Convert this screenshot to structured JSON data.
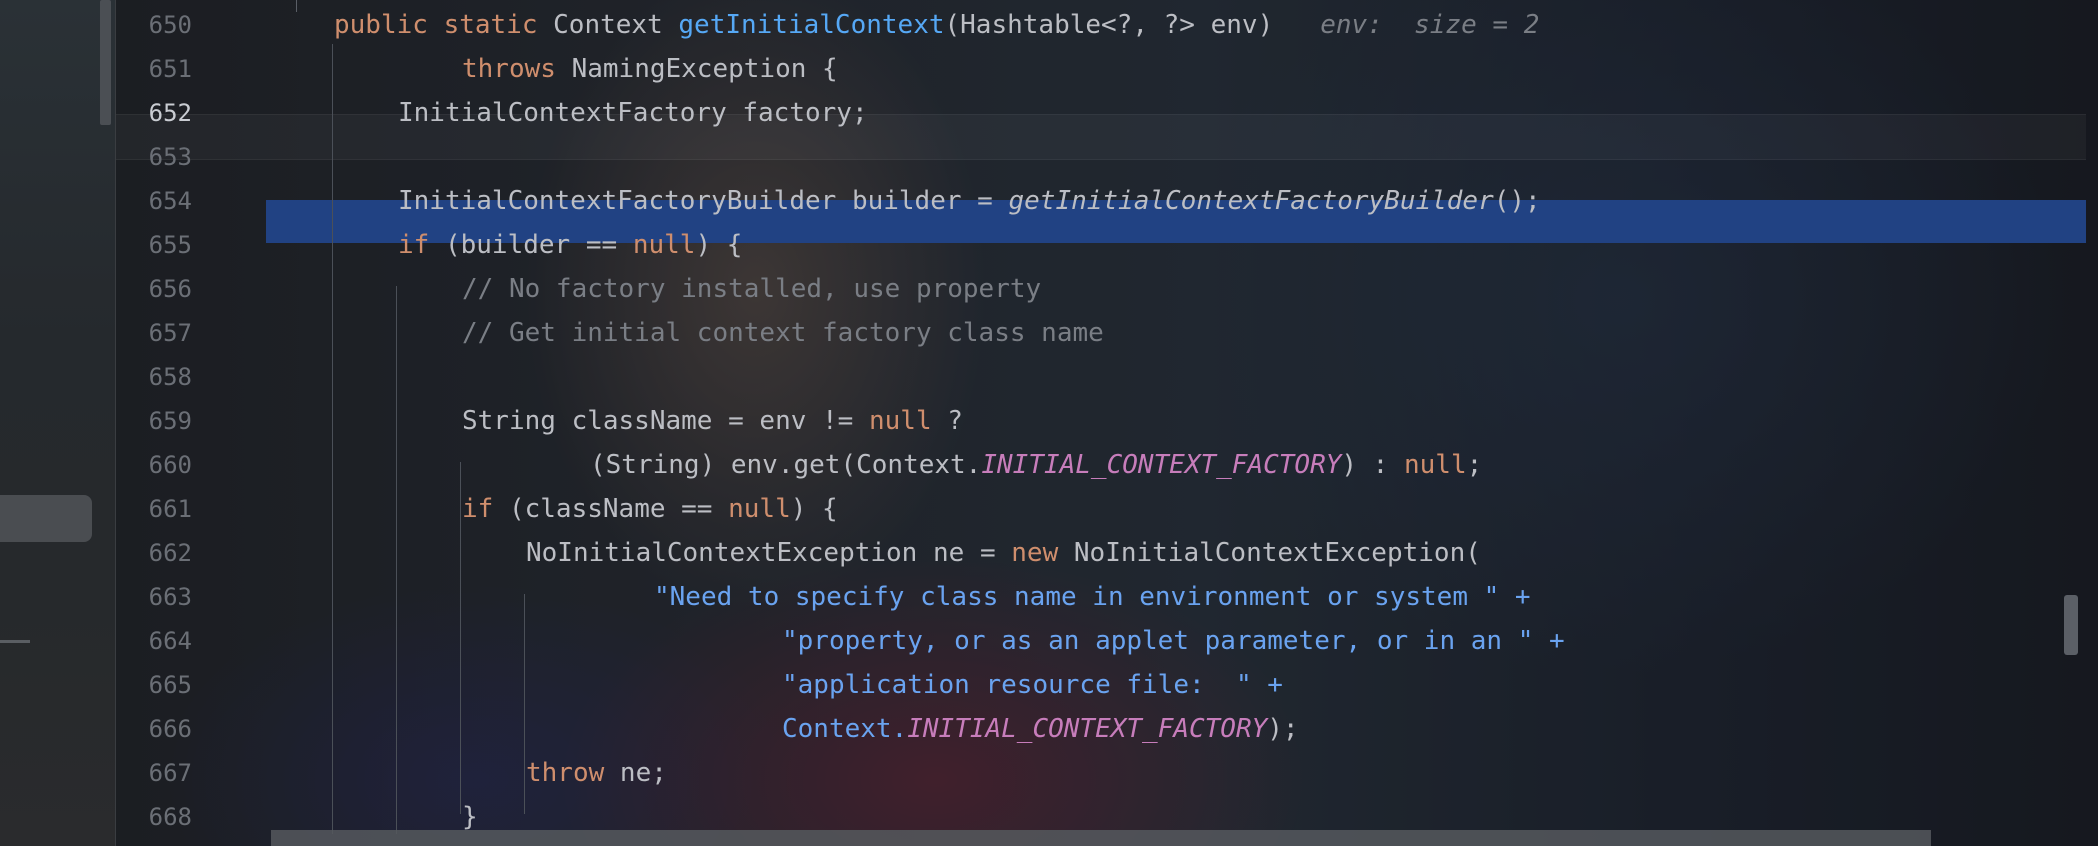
{
  "editor": {
    "lines": [
      {
        "num": "650",
        "indent": 0,
        "tokens": [
          {
            "t": "public static ",
            "c": "kw"
          },
          {
            "t": "Context "
          },
          {
            "t": "getInitialContext",
            "c": "fn"
          },
          {
            "t": "(Hashtable<?, ?> env)"
          },
          {
            "t": "   env:  size = 2",
            "c": "hint"
          }
        ]
      },
      {
        "num": "651",
        "indent": 2,
        "tokens": [
          {
            "t": "throws ",
            "c": "kw"
          },
          {
            "t": "NamingException {"
          }
        ]
      },
      {
        "num": "652",
        "indent": 1,
        "active": true,
        "tokens": [
          {
            "t": "InitialContextFactory factory;"
          }
        ]
      },
      {
        "num": "653",
        "indent": 0,
        "tokens": []
      },
      {
        "num": "654",
        "indent": 1,
        "tokens": [
          {
            "t": "InitialContextFactoryBuilder builder = "
          },
          {
            "t": "getInitialContextFactoryBuilder",
            "c": "it"
          },
          {
            "t": "();"
          }
        ]
      },
      {
        "num": "655",
        "indent": 1,
        "tokens": [
          {
            "t": "if ",
            "c": "kw"
          },
          {
            "t": "(builder == "
          },
          {
            "t": "null",
            "c": "kw"
          },
          {
            "t": ") {"
          }
        ]
      },
      {
        "num": "656",
        "indent": 2,
        "tokens": [
          {
            "t": "// No factory installed, use property",
            "c": "cm"
          }
        ]
      },
      {
        "num": "657",
        "indent": 2,
        "tokens": [
          {
            "t": "// Get initial context factory class name",
            "c": "cm"
          }
        ]
      },
      {
        "num": "658",
        "indent": 0,
        "tokens": []
      },
      {
        "num": "659",
        "indent": 2,
        "tokens": [
          {
            "t": "String className = env != "
          },
          {
            "t": "null",
            "c": "kw"
          },
          {
            "t": " ?"
          }
        ]
      },
      {
        "num": "660",
        "indent": 4,
        "tokens": [
          {
            "t": "(String) env.get(Context."
          },
          {
            "t": "INITIAL_CONTEXT_FACTORY",
            "c": "cn"
          },
          {
            "t": ") : "
          },
          {
            "t": "null",
            "c": "kw"
          },
          {
            "t": ";"
          }
        ]
      },
      {
        "num": "661",
        "indent": 2,
        "tokens": [
          {
            "t": "if ",
            "c": "kw"
          },
          {
            "t": "(className == "
          },
          {
            "t": "null",
            "c": "kw"
          },
          {
            "t": ") {"
          }
        ]
      },
      {
        "num": "662",
        "indent": 3,
        "tokens": [
          {
            "t": "NoInitialContextException ne = "
          },
          {
            "t": "new ",
            "c": "kw"
          },
          {
            "t": "NoInitialContextException("
          }
        ]
      },
      {
        "num": "663",
        "indent": 5,
        "tokens": [
          {
            "t": "\"Need to specify class name in environment or system \" +",
            "c": "st"
          }
        ]
      },
      {
        "num": "664",
        "indent": 7,
        "tokens": [
          {
            "t": "\"property, or as an applet parameter, or in an \" +",
            "c": "st"
          }
        ]
      },
      {
        "num": "665",
        "indent": 7,
        "tokens": [
          {
            "t": "\"application resource file:  \" +",
            "c": "st"
          }
        ]
      },
      {
        "num": "666",
        "indent": 7,
        "tokens": [
          {
            "t": "Context.",
            "c": "st"
          },
          {
            "t": "INITIAL_CONTEXT_FACTORY",
            "c": "cn"
          },
          {
            "t": ");"
          }
        ]
      },
      {
        "num": "667",
        "indent": 3,
        "tokens": [
          {
            "t": "throw ",
            "c": "kw"
          },
          {
            "t": "ne;"
          }
        ]
      },
      {
        "num": "668",
        "indent": 2,
        "tokens": [
          {
            "t": "}"
          }
        ]
      }
    ],
    "colors": {
      "keyword": "#cf8e6d",
      "function": "#56a8f5",
      "comment": "#7a7e85",
      "string": "#6aa3f0",
      "constant": "#c77dbb",
      "selection": "#214283"
    }
  }
}
